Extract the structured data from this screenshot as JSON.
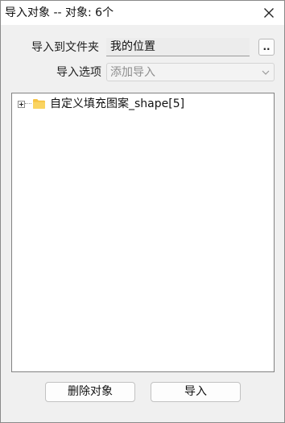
{
  "window": {
    "title": "导入对象 -- 对象: 6个"
  },
  "form": {
    "folder_label": "导入到文件夹",
    "folder_value": "我的位置",
    "browse_label": "..",
    "options_label": "导入选项",
    "options_value": "添加导入"
  },
  "tree": {
    "nodes": [
      {
        "label": "自定义填充图案_shape[5]",
        "expanded": false,
        "icon": "folder-icon"
      }
    ]
  },
  "buttons": {
    "delete_label": "删除对象",
    "import_label": "导入"
  },
  "colors": {
    "folder_icon": "#f6c343",
    "window_bg": "#f0f0f0"
  }
}
